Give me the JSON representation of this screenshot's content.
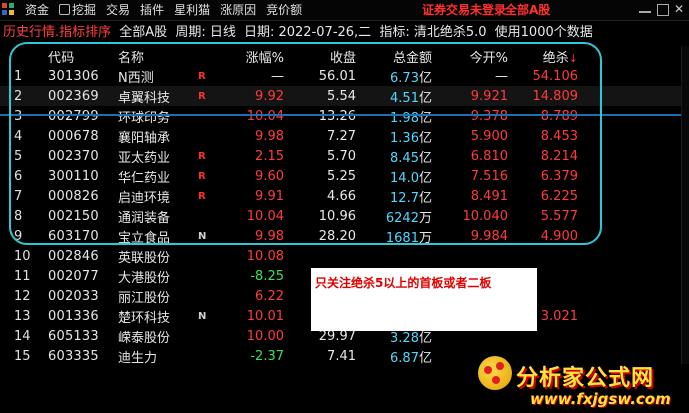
{
  "menu": {
    "items": [
      "资金",
      "挖掘",
      "交易",
      "插件",
      "星利猫",
      "涨原因",
      "竞价额"
    ],
    "login_status": "证券交易未登录",
    "market_link": "全部A股"
  },
  "info": {
    "hist": "历史行情.指标排序",
    "scope": "全部A股",
    "period": "周期: 日线",
    "date": "日期: 2022-07-26,二",
    "indicator": "指标: 清北绝杀5.0",
    "count": "使用1000个数据"
  },
  "headers": {
    "code": "代码",
    "name": "名称",
    "chg": "涨幅%",
    "close": "收盘",
    "amount": "总金额",
    "open": "今开%",
    "jue": "绝杀",
    "sort_arrow": "↓"
  },
  "rows": [
    {
      "idx": "1",
      "code": "301306",
      "name": "N西测",
      "flag": "R",
      "chg": "—",
      "chg_c": "wht",
      "close": "56.01",
      "amt": "6.73",
      "unit": "亿",
      "open": "—",
      "open_c": "wht",
      "jue": "54.106",
      "jue_c": "red"
    },
    {
      "idx": "2",
      "code": "002369",
      "name": "卓翼科技",
      "flag": "R",
      "chg": "9.92",
      "chg_c": "red",
      "close": "5.54",
      "amt": "4.51",
      "unit": "亿",
      "open": "9.921",
      "open_c": "red",
      "jue": "14.809",
      "jue_c": "red"
    },
    {
      "idx": "3",
      "code": "002799",
      "name": "环球印务",
      "flag": "",
      "chg": "10.04",
      "chg_c": "red",
      "close": "13.26",
      "amt": "1.98",
      "unit": "亿",
      "open": "9.378",
      "open_c": "red",
      "jue": "8.789",
      "jue_c": "red"
    },
    {
      "idx": "4",
      "code": "000678",
      "name": "襄阳轴承",
      "flag": "",
      "chg": "9.98",
      "chg_c": "red",
      "close": "7.27",
      "amt": "1.36",
      "unit": "亿",
      "open": "5.900",
      "open_c": "red",
      "jue": "8.453",
      "jue_c": "red"
    },
    {
      "idx": "5",
      "code": "002370",
      "name": "亚太药业",
      "flag": "R",
      "chg": "2.15",
      "chg_c": "red",
      "close": "5.70",
      "amt": "8.45",
      "unit": "亿",
      "open": "6.810",
      "open_c": "red",
      "jue": "8.214",
      "jue_c": "red"
    },
    {
      "idx": "6",
      "code": "300110",
      "name": "华仁药业",
      "flag": "R",
      "chg": "9.60",
      "chg_c": "red",
      "close": "5.25",
      "amt": "14.0",
      "unit": "亿",
      "open": "7.516",
      "open_c": "red",
      "jue": "6.379",
      "jue_c": "red"
    },
    {
      "idx": "7",
      "code": "000826",
      "name": "启迪环境",
      "flag": "R",
      "chg": "9.91",
      "chg_c": "red",
      "close": "4.66",
      "amt": "12.7",
      "unit": "亿",
      "open": "8.491",
      "open_c": "red",
      "jue": "6.225",
      "jue_c": "red"
    },
    {
      "idx": "8",
      "code": "002150",
      "name": "通润装备",
      "flag": "",
      "chg": "10.04",
      "chg_c": "red",
      "close": "10.96",
      "amt": "6242",
      "unit": "万",
      "open": "10.040",
      "open_c": "red",
      "jue": "5.577",
      "jue_c": "red"
    },
    {
      "idx": "9",
      "code": "603170",
      "name": "宝立食品",
      "flag": "N",
      "chg": "9.98",
      "chg_c": "red",
      "close": "28.20",
      "amt": "1681",
      "unit": "万",
      "open": "9.984",
      "open_c": "red",
      "jue": "4.900",
      "jue_c": "red"
    },
    {
      "idx": "10",
      "code": "002846",
      "name": "英联股份",
      "flag": "",
      "chg": "10.08",
      "chg_c": "red",
      "close": "",
      "amt": "",
      "unit": "",
      "open": "",
      "open_c": "red",
      "jue": "",
      "jue_c": "red"
    },
    {
      "idx": "11",
      "code": "002077",
      "name": "大港股份",
      "flag": "",
      "chg": "-8.25",
      "chg_c": "grn",
      "close": "",
      "amt": "",
      "unit": "",
      "open": "",
      "open_c": "red",
      "jue": "",
      "jue_c": "red"
    },
    {
      "idx": "12",
      "code": "002033",
      "name": "丽江股份",
      "flag": "",
      "chg": "6.22",
      "chg_c": "red",
      "close": "",
      "amt": "",
      "unit": "",
      "open": "",
      "open_c": "red",
      "jue": "",
      "jue_c": "red"
    },
    {
      "idx": "13",
      "code": "001336",
      "name": "楚环科技",
      "flag": "N",
      "chg": "10.01",
      "chg_c": "red",
      "close": "36.37",
      "amt": "988.5",
      "unit": "万",
      "open": "10.012",
      "open_c": "red",
      "jue": "3.021",
      "jue_c": "red"
    },
    {
      "idx": "14",
      "code": "605133",
      "name": "嵘泰股份",
      "flag": "",
      "chg": "10.00",
      "chg_c": "red",
      "close": "29.97",
      "amt": "3.28",
      "unit": "亿",
      "open": "",
      "open_c": "red",
      "jue": "",
      "jue_c": "red"
    },
    {
      "idx": "15",
      "code": "603335",
      "name": "迪生力",
      "flag": "",
      "chg": "-2.37",
      "chg_c": "grn",
      "close": "7.41",
      "amt": "6.87",
      "unit": "亿",
      "open": "",
      "open_c": "red",
      "jue": "",
      "jue_c": "red"
    }
  ],
  "note": "只关注绝杀5以上的首板或者二板",
  "watermark": {
    "title": "分析家公式网",
    "url": "www.fxjgsw.com"
  }
}
